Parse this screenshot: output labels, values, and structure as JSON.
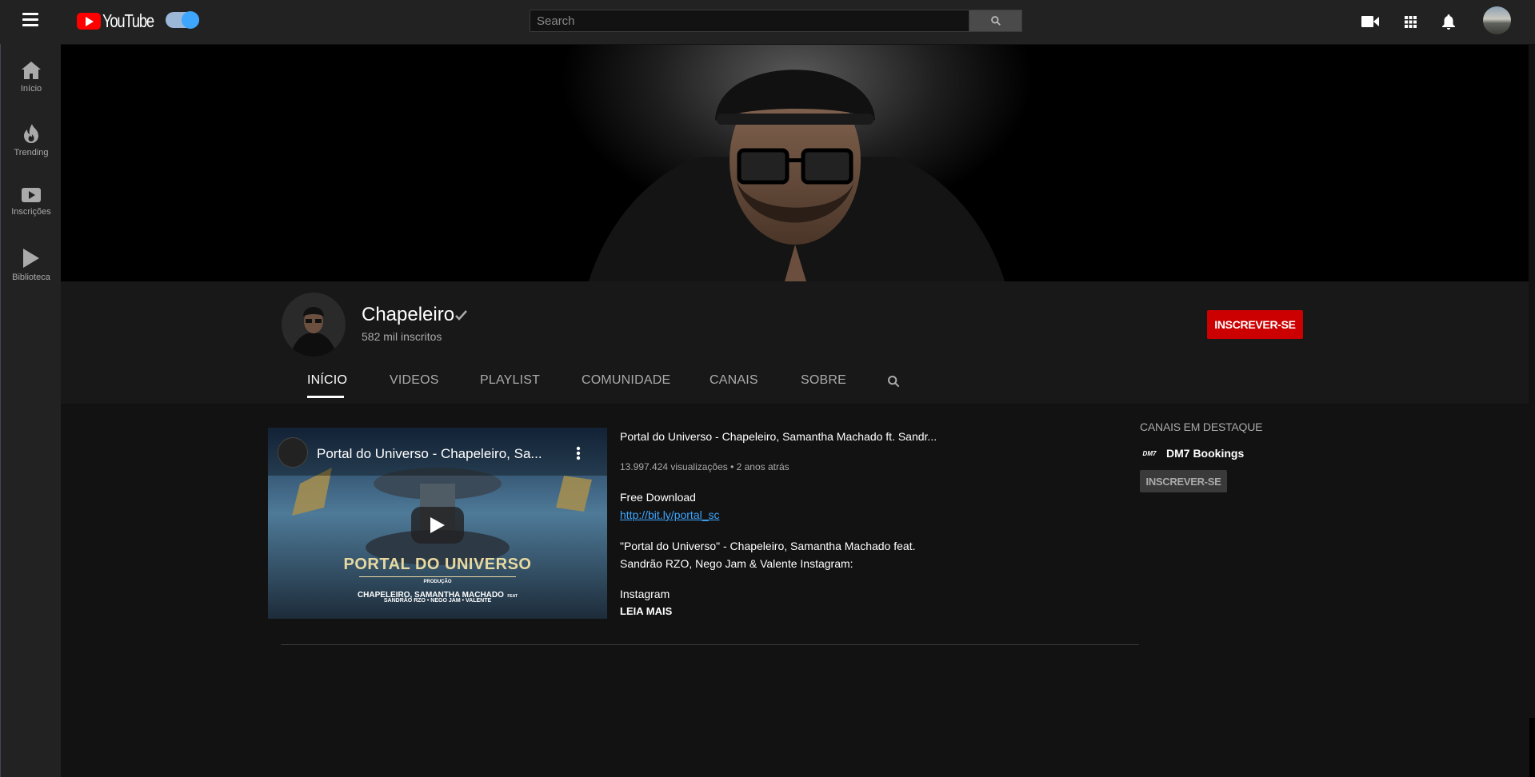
{
  "header": {
    "logo_text": "YouTube",
    "search_placeholder": "Search",
    "search_value": "",
    "icons": [
      "menu-icon",
      "video-camera-icon",
      "apps-grid-icon",
      "bell-icon",
      "search-icon"
    ]
  },
  "sidebar": {
    "items": [
      {
        "label": "Início",
        "icon": "home-icon"
      },
      {
        "label": "Trending",
        "icon": "flame-icon"
      },
      {
        "label": "Inscrições",
        "icon": "subscriptions-icon"
      },
      {
        "label": "Biblioteca",
        "icon": "library-icon"
      }
    ]
  },
  "channel": {
    "name": "Chapeleiro",
    "subscribers": "582 mil inscritos",
    "subscribe_label": "INSCREVER-SE",
    "tabs": [
      "INÍCIO",
      "VIDEOS",
      "PLAYLIST",
      "COMUNIDADE",
      "CANAIS",
      "SOBRE"
    ],
    "active_tab": "INÍCIO"
  },
  "featured_video": {
    "overlay_title": "Portal do Universo - Chapeleiro, Sa...",
    "thumb_title": "PORTAL DO UNIVERSO",
    "thumb_producao": "PRODUÇÃO",
    "thumb_line1": "CHAPELEIRO, SAMANTHA MACHADO",
    "thumb_feat": "FEAT",
    "thumb_line2": "SANDRÃO RZO • NEGO JAM • VALENTE",
    "title": "Portal do Universo - Chapeleiro, Samantha Machado ft. Sandr...",
    "meta": "13.997.424 visualizações • 2 anos atrás",
    "desc_free": "Free Download",
    "link": "http://bit.ly/portal_sc",
    "desc_line1": "\"Portal do Universo\" - Chapeleiro, Samantha Machado feat.",
    "desc_line2": "Sandrão RZO, Nego Jam & Valente Instagram:",
    "desc_instagram": "Instagram",
    "read_more": "LEIA MAIS"
  },
  "featured_channels": {
    "title": "CANAIS EM DESTAQUE",
    "items": [
      {
        "name": "DM7 Bookings",
        "logo_text": "DM7",
        "subscribe_label": "INSCREVER-SE"
      }
    ]
  },
  "colors": {
    "accent_red": "#cc0000",
    "link_blue": "#3ea6ff",
    "toggle_blue": "#3ea6ff"
  }
}
